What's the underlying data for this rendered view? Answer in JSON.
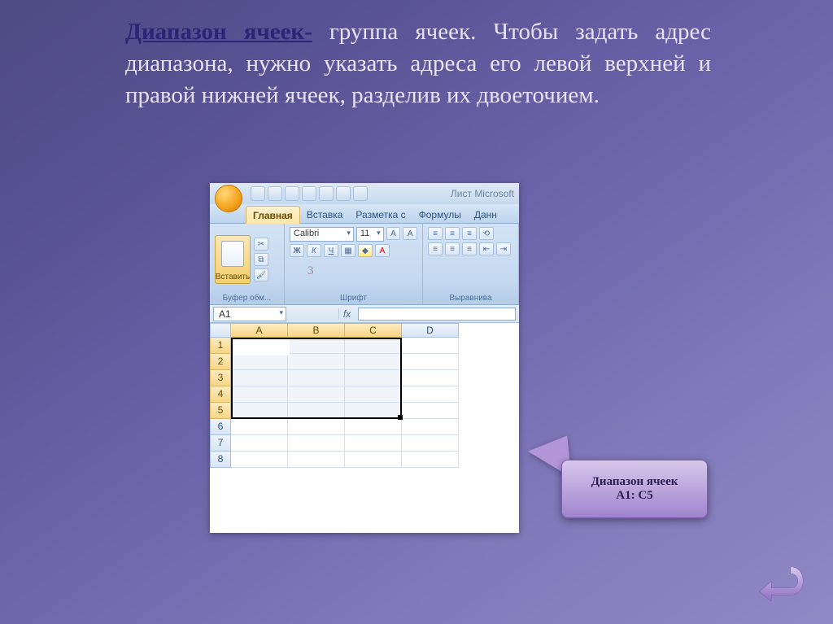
{
  "text": {
    "term": "Диапазон ячеек-",
    "definition": " группа ячеек. Чтобы задать адрес диапазона, нужно указать адреса его левой верхней и правой нижней ячеек, разделив их двоеточием."
  },
  "excel": {
    "window_title": "Лист Microsoft",
    "tabs": [
      "Главная",
      "Вставка",
      "Разметка с",
      "Формулы",
      "Данн"
    ],
    "active_tab_index": 0,
    "ribbon": {
      "paste_label": "Вставить",
      "group_clipboard": "Буфер обм...",
      "group_font": "Шрифт",
      "group_align": "Выравнива",
      "font_name": "Calibri",
      "font_size": "11"
    },
    "name_box": "A1",
    "fx_label": "fx",
    "columns": [
      "A",
      "B",
      "C",
      "D"
    ],
    "row_count": 8,
    "selected_rows": [
      1,
      2,
      3,
      4,
      5
    ],
    "selected_cols": [
      "A",
      "B",
      "C"
    ],
    "selection_range": "A1:C5"
  },
  "ghost": "3",
  "callout": {
    "line1": "Диапазон ячеек",
    "line2": "А1: С5"
  },
  "nav": {
    "back_label": "back"
  }
}
